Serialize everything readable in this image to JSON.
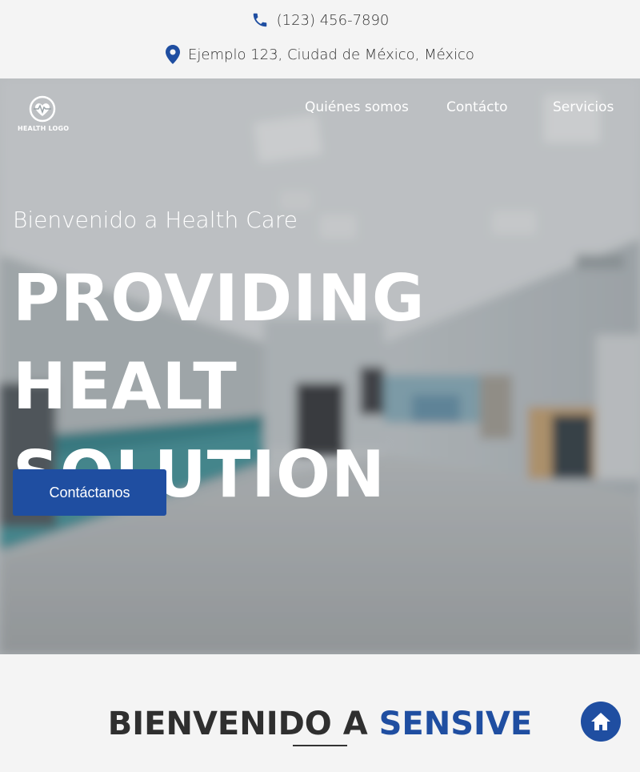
{
  "topbar": {
    "phone": "(123) 456-7890",
    "address": "Ejemplo 123, Ciudad de México, México",
    "phone_icon": "phone-icon",
    "location_icon": "map-pin-icon"
  },
  "navbar": {
    "logo_text": "HEALTH LOGO",
    "links": [
      "Quiénes somos",
      "Contácto",
      "Servicios"
    ]
  },
  "hero": {
    "welcome": "Bienvenido a Health Care",
    "headline_line1": "PROVIDING HEALT",
    "headline_line2": "SOLUTION",
    "cta_label": "Contáctanos"
  },
  "section": {
    "title_part1": "BIENVENIDO A ",
    "title_part2": "SENSIVE"
  },
  "colors": {
    "accent": "#1f4ea1",
    "background": "#f4f4f4",
    "text": "#2f2f2f"
  },
  "floating": {
    "home_icon": "home-icon"
  }
}
